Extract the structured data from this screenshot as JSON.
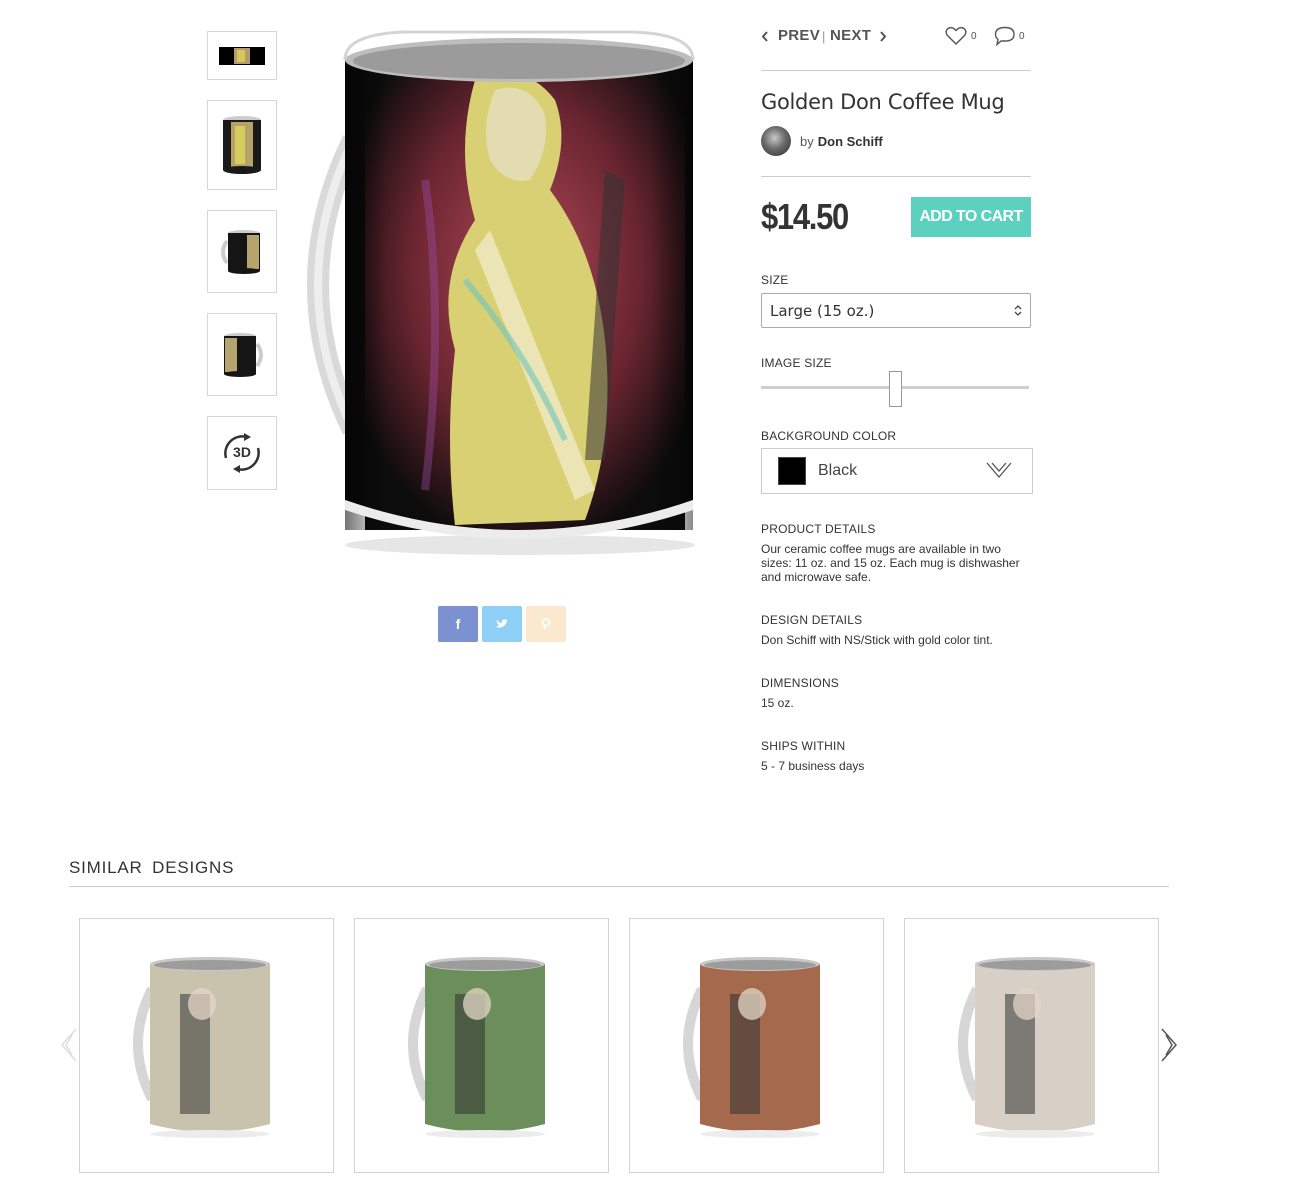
{
  "nav": {
    "prev": "PREV",
    "separator": "|",
    "next": "NEXT",
    "likes": "0",
    "comments": "0"
  },
  "product": {
    "title": "Golden Don Coffee Mug",
    "by": "by",
    "artist": "Don Schiff",
    "price": "$14.50",
    "add_to_cart": "ADD TO CART"
  },
  "options": {
    "size_label": "SIZE",
    "size_value": "Large (15 oz.)",
    "image_size_label": "IMAGE SIZE",
    "image_size_level": 0.5,
    "bg_label": "BACKGROUND COLOR",
    "bg_value": "Black",
    "bg_color": "#000000"
  },
  "details": {
    "product_label": "PRODUCT DETAILS",
    "product_text": "Our ceramic coffee mugs are available in two sizes: 11 oz. and 15 oz. Each mug is dishwasher and microwave safe.",
    "design_label": "DESIGN DETAILS",
    "design_text": "Don Schiff with NS/Stick with gold color tint.",
    "dimensions_label": "DIMENSIONS",
    "dimensions_text": "15 oz.",
    "ships_label": "SHIPS WITHIN",
    "ships_text": "5 - 7 business days"
  },
  "thumb_3d_label": "3D",
  "share": {
    "facebook": "f",
    "twitter": "t",
    "pinterest": "p"
  },
  "colors": {
    "accent": "#5dd1c0",
    "facebook": "#7b91d0",
    "twitter": "#8ed0f5",
    "pinterest": "#fbe9cf"
  },
  "similar": {
    "title": "SIMILAR  DESIGNS",
    "items": [
      {
        "name": "mug-two-guitarists",
        "bg": "#c9c3ae"
      },
      {
        "name": "mug-desert-landscape",
        "bg": "#6b8e5a"
      },
      {
        "name": "mug-cellist",
        "bg": "#a56a4d"
      },
      {
        "name": "mug-couple-portrait",
        "bg": "#d8d0c6"
      }
    ]
  }
}
